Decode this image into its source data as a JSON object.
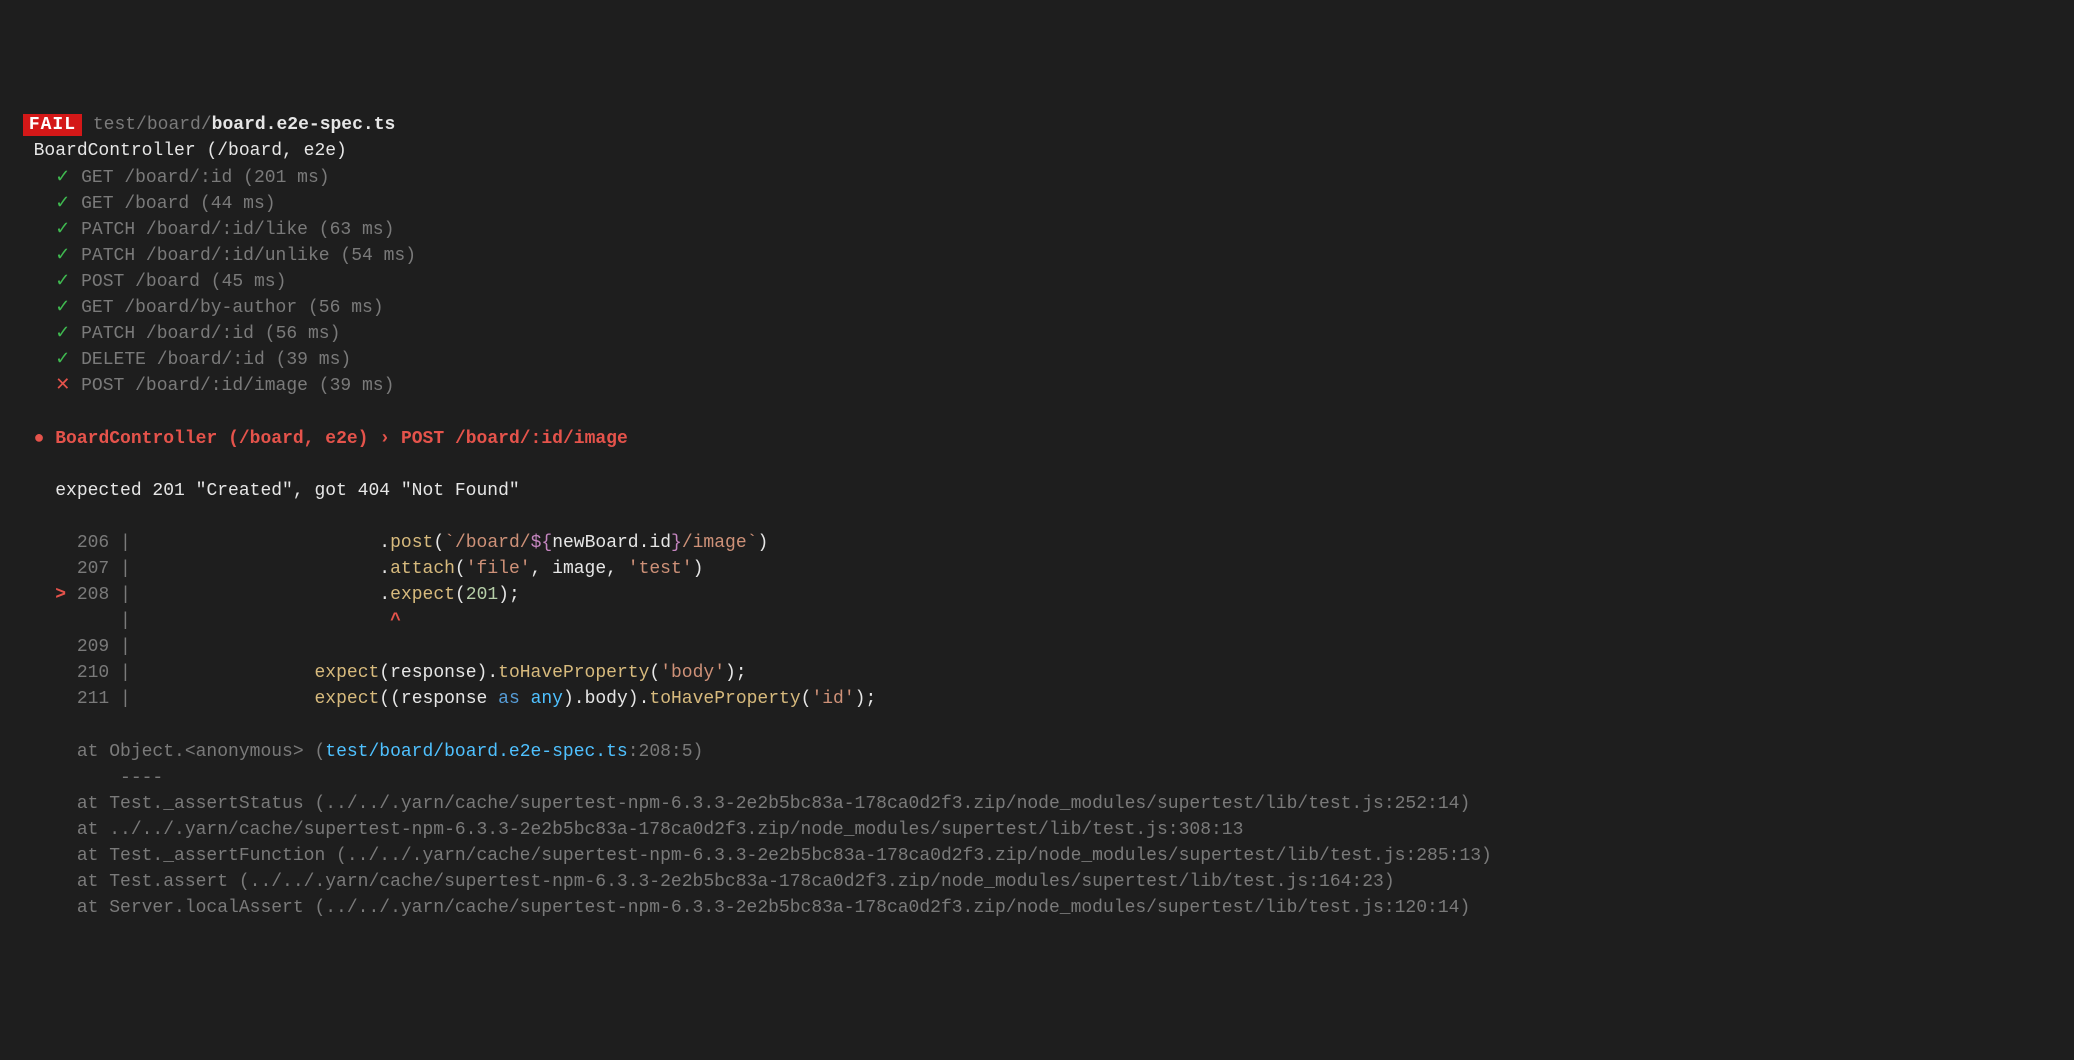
{
  "header": {
    "badge": "FAIL",
    "path_dim": "test/board/",
    "path_file": "board.e2e-spec.ts"
  },
  "suite": {
    "title": "BoardController (/board, e2e)",
    "tests": [
      {
        "mark": "✓",
        "pass": true,
        "name": "GET /board/:id",
        "time": "(201 ms)"
      },
      {
        "mark": "✓",
        "pass": true,
        "name": "GET /board",
        "time": "(44 ms)"
      },
      {
        "mark": "✓",
        "pass": true,
        "name": "PATCH /board/:id/like",
        "time": "(63 ms)"
      },
      {
        "mark": "✓",
        "pass": true,
        "name": "PATCH /board/:id/unlike",
        "time": "(54 ms)"
      },
      {
        "mark": "✓",
        "pass": true,
        "name": "POST /board",
        "time": "(45 ms)"
      },
      {
        "mark": "✓",
        "pass": true,
        "name": "GET /board/by-author",
        "time": "(56 ms)"
      },
      {
        "mark": "✓",
        "pass": true,
        "name": "PATCH /board/:id",
        "time": "(56 ms)"
      },
      {
        "mark": "✓",
        "pass": true,
        "name": "DELETE /board/:id",
        "time": "(39 ms)"
      },
      {
        "mark": "✕",
        "pass": false,
        "name": "POST /board/:id/image",
        "time": "(39 ms)"
      }
    ]
  },
  "failure": {
    "bullet": "●",
    "describe": "BoardController (/board, e2e)",
    "arrow": "›",
    "test": "POST /board/:id/image",
    "message": "expected 201 \"Created\", got 404 \"Not Found\""
  },
  "code": {
    "l206": {
      "num": "206",
      "pipe": "|",
      "indent": "                      ",
      "dot": ".",
      "method": "post",
      "args_open": "(",
      "template_open": "`",
      "t1": "/board/",
      "interp_open": "${",
      "ident": "newBoard.id",
      "interp_close": "}",
      "t2": "/image",
      "template_close": "`",
      "args_close": ")"
    },
    "l207": {
      "num": "207",
      "pipe": "|",
      "indent": "                      ",
      "dot": ".",
      "method": "attach",
      "args_open": "(",
      "s1": "'file'",
      "comma1": ", ",
      "ident": "image",
      "comma2": ", ",
      "s2": "'test'",
      "args_close": ")"
    },
    "l208": {
      "marker": ">",
      "num": "208",
      "pipe": "|",
      "indent": "                      ",
      "dot": ".",
      "method": "expect",
      "args_open": "(",
      "val": "201",
      "args_close": ");"
    },
    "caret_line": {
      "pipe": "|",
      "indent": "                       ",
      "caret": "^"
    },
    "l209": {
      "num": "209",
      "pipe": "|"
    },
    "l210": {
      "num": "210",
      "pipe": "|",
      "indent": "                ",
      "fn": "expect",
      "args_open": "(",
      "id": "response",
      "args_close": ").",
      "m2": "toHaveProperty",
      "p_open": "(",
      "s": "'body'",
      "p_close": ");"
    },
    "l211": {
      "num": "211",
      "pipe": "|",
      "indent": "                ",
      "fn": "expect",
      "args_open": "((",
      "id": "response",
      "sp": " ",
      "kw": "as",
      "sp2": " ",
      "anykw": "any",
      "args_close": ").",
      "prop": "body",
      "close2": ").",
      "m2": "toHaveProperty",
      "p_open": "(",
      "s": "'id'",
      "p_close": ");"
    }
  },
  "stack": {
    "at1_pre": "at Object.<anonymous> (",
    "at1_link": "test/board/board.e2e-spec.ts",
    "at1_post": ":208:5)",
    "dashes": "----",
    "at2": "at Test._assertStatus (../../.yarn/cache/supertest-npm-6.3.3-2e2b5bc83a-178ca0d2f3.zip/node_modules/supertest/lib/test.js:252:14)",
    "at3": "at ../../.yarn/cache/supertest-npm-6.3.3-2e2b5bc83a-178ca0d2f3.zip/node_modules/supertest/lib/test.js:308:13",
    "at4": "at Test._assertFunction (../../.yarn/cache/supertest-npm-6.3.3-2e2b5bc83a-178ca0d2f3.zip/node_modules/supertest/lib/test.js:285:13)",
    "at5": "at Test.assert (../../.yarn/cache/supertest-npm-6.3.3-2e2b5bc83a-178ca0d2f3.zip/node_modules/supertest/lib/test.js:164:23)",
    "at6": "at Server.localAssert (../../.yarn/cache/supertest-npm-6.3.3-2e2b5bc83a-178ca0d2f3.zip/node_modules/supertest/lib/test.js:120:14)"
  }
}
